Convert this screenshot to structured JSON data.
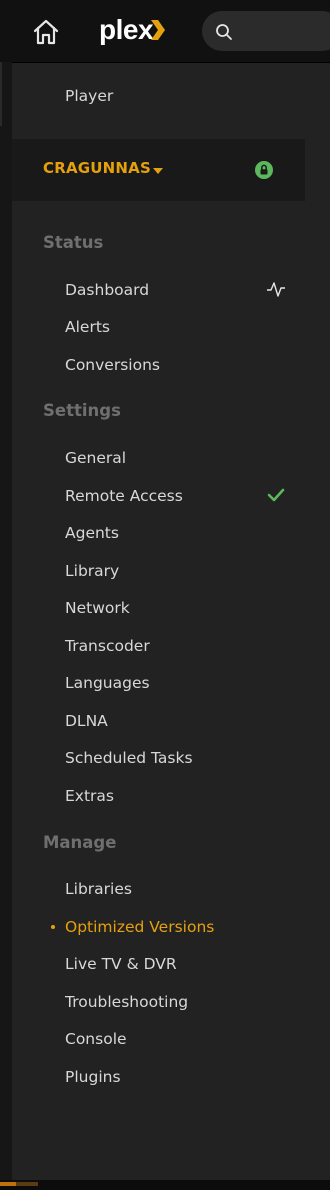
{
  "brand": {
    "logo_text": "plex",
    "accent": "#e5a00d"
  },
  "search": {
    "placeholder": ""
  },
  "nav": {
    "player": "Player",
    "server": {
      "name": "CRAGUNNAS"
    },
    "sections": {
      "status": "Status",
      "settings": "Settings",
      "manage": "Manage"
    },
    "status_items": [
      "Dashboard",
      "Alerts",
      "Conversions"
    ],
    "settings_items": [
      "General",
      "Remote Access",
      "Agents",
      "Library",
      "Network",
      "Transcoder",
      "Languages",
      "DLNA",
      "Scheduled Tasks",
      "Extras"
    ],
    "manage_items": [
      "Libraries",
      "Optimized Versions",
      "Live TV & DVR",
      "Troubleshooting",
      "Console",
      "Plugins"
    ],
    "active_item": "Optimized Versions"
  },
  "indicators": {
    "dashboard_icon": "activity-icon",
    "remote_access_icon": "check-icon",
    "server_icon": "lock-icon",
    "remote_access_status_color": "#5cb85c"
  },
  "playback_progress": 0.05
}
